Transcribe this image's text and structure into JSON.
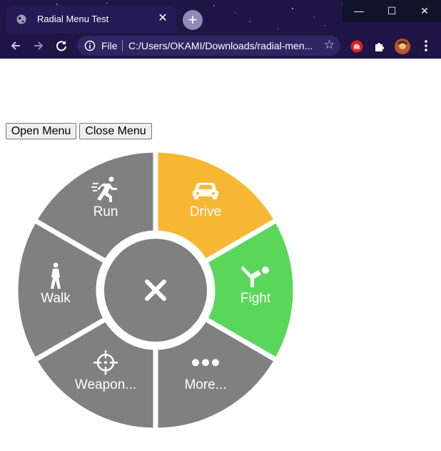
{
  "browser": {
    "tab_title": "Radial Menu Test",
    "scheme_label": "File",
    "url": "C:/Users/OKAMI/Downloads/radial-men...",
    "tab_close": "✕",
    "new_tab": "+",
    "window_min": "—",
    "window_max": "☐",
    "window_close": "✕"
  },
  "page": {
    "open_button": "Open Menu",
    "close_button": "Close Menu"
  },
  "radial_menu": {
    "center_icon": "close-x-icon",
    "segments": [
      {
        "id": "drive",
        "label": "Drive",
        "icon": "car-icon",
        "color": "#f8b733"
      },
      {
        "id": "fight",
        "label": "Fight",
        "icon": "kick-icon",
        "color": "#5ad75a"
      },
      {
        "id": "more",
        "label": "More...",
        "icon": "ellipsis-icon",
        "color": "#808080"
      },
      {
        "id": "weapon",
        "label": "Weapon...",
        "icon": "crosshair-icon",
        "color": "#808080"
      },
      {
        "id": "walk",
        "label": "Walk",
        "icon": "walk-icon",
        "color": "#808080"
      },
      {
        "id": "run",
        "label": "Run",
        "icon": "run-icon",
        "color": "#808080"
      }
    ],
    "center_color": "#808080"
  }
}
